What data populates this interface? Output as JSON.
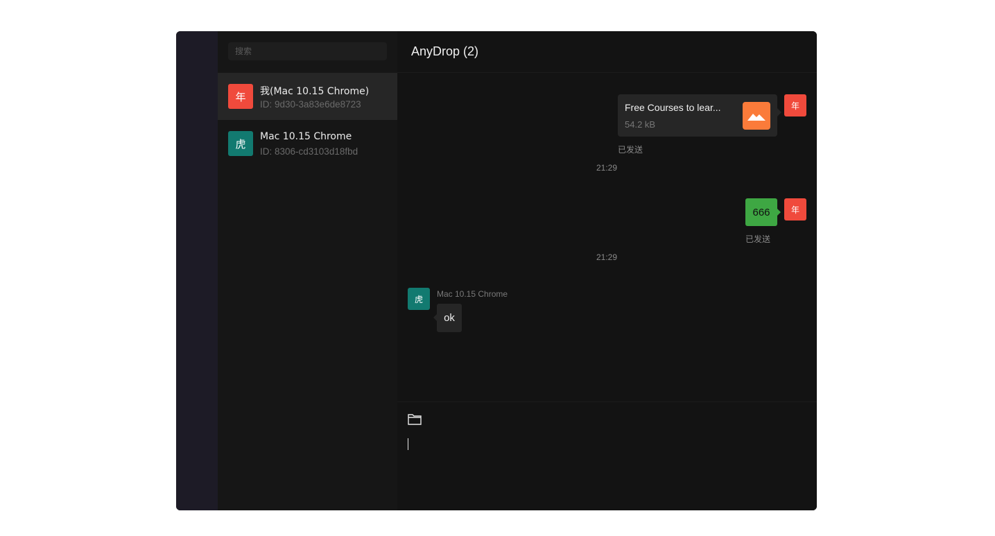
{
  "app": {
    "title": "AnyDrop (2)"
  },
  "search": {
    "placeholder": "搜索"
  },
  "contacts": [
    {
      "avatar": "年",
      "name": "我(Mac 10.15 Chrome)",
      "id": "ID: 9d30-3a83e6de8723",
      "color": "#f04a3c",
      "active": true
    },
    {
      "avatar": "虎",
      "name": "Mac 10.15 Chrome",
      "id": "ID: 8306-cd3103d18fbd",
      "color": "#127a70",
      "active": false
    }
  ],
  "messages": {
    "file": {
      "name": "Free Courses to lear...",
      "size": "54.2 kB",
      "status": "已发送",
      "avatar": "年",
      "icon": "image-file-icon"
    },
    "time1": "21:29",
    "text": {
      "content": "666",
      "status": "已发送",
      "avatar": "年"
    },
    "time2": "21:29",
    "incoming": {
      "sender": "Mac 10.15 Chrome",
      "content": "ok",
      "avatar": "虎"
    }
  },
  "composer": {
    "icon": "folder-icon"
  },
  "colors": {
    "accent_red": "#f04a3c",
    "accent_teal": "#127a70",
    "bubble_green": "#3ea743",
    "file_orange": "#fb7b3a"
  }
}
